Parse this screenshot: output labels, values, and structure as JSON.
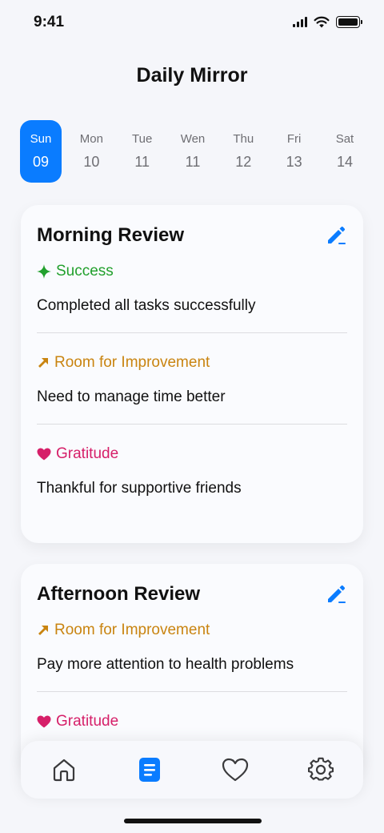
{
  "status_bar": {
    "time": "9:41"
  },
  "title": "Daily Mirror",
  "week": {
    "days": [
      {
        "name": "Sun",
        "num": "09",
        "active": true
      },
      {
        "name": "Mon",
        "num": "10",
        "active": false
      },
      {
        "name": "Tue",
        "num": "11",
        "active": false
      },
      {
        "name": "Wen",
        "num": "11",
        "active": false
      },
      {
        "name": "Thu",
        "num": "12",
        "active": false
      },
      {
        "name": "Fri",
        "num": "13",
        "active": false
      },
      {
        "name": "Sat",
        "num": "14",
        "active": false
      }
    ]
  },
  "cards": [
    {
      "title": "Morning Review",
      "sections": [
        {
          "icon": "sparkle-icon",
          "label": "Success",
          "text": "Completed all tasks successfully"
        },
        {
          "icon": "arrow-up-right-icon",
          "label": "Room for Improvement",
          "text": "Need to manage time better"
        },
        {
          "icon": "heart-icon",
          "label": "Gratitude",
          "text": "Thankful for supportive friends"
        }
      ]
    },
    {
      "title": "Afternoon Review",
      "sections": [
        {
          "icon": "arrow-up-right-icon",
          "label": "Room for Improvement",
          "text": "Pay more attention to health problems"
        },
        {
          "icon": "heart-icon",
          "label": "Gratitude",
          "text": ""
        }
      ]
    }
  ],
  "nav": {
    "items": [
      {
        "icon": "home-icon",
        "active": false
      },
      {
        "icon": "document-icon",
        "active": true
      },
      {
        "icon": "heart-icon",
        "active": false
      },
      {
        "icon": "gear-icon",
        "active": false
      }
    ]
  },
  "colors": {
    "accent": "#0a7cff",
    "success": "#22a02d",
    "improvement": "#c98410",
    "gratitude": "#d61f69"
  }
}
